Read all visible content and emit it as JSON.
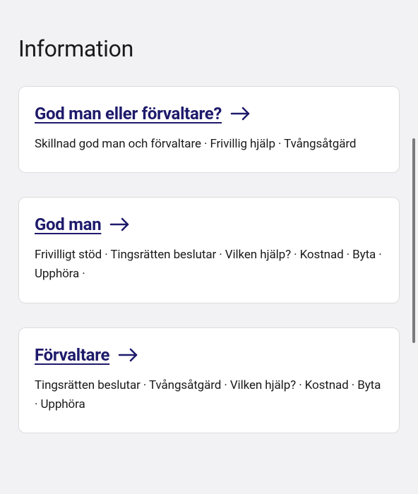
{
  "pageTitle": "Information",
  "cards": [
    {
      "title": "God man eller förvaltare?",
      "tags": "Skillnad god man och förvaltare  ·  Frivillig hjälp  ·  Tvångsåtgärd"
    },
    {
      "title": "God man",
      "tags": "Frivilligt stöd  ·  Tingsrätten beslutar  ·  Vilken hjälp?  ·  Kostnad  ·  Byta  ·  Upphöra  ·"
    },
    {
      "title": "Förvaltare",
      "tags": "Tingsrätten beslutar  ·  Tvångsåtgärd  ·  Vilken hjälp?  ·  Kostnad  ·  Byta  ·  Upphöra"
    }
  ]
}
